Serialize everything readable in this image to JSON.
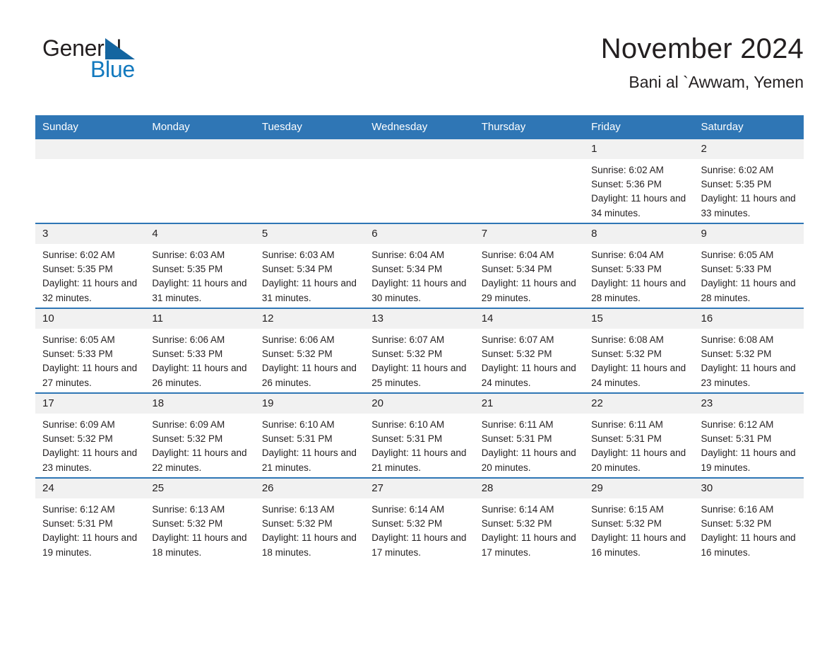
{
  "brand": {
    "word_one": "General",
    "word_two": "Blue",
    "accent_color": "#1279be",
    "triangle_color": "#1465a0"
  },
  "header": {
    "title": "November 2024",
    "subtitle": "Bani al `Awwam, Yemen"
  },
  "theme": {
    "header_row_bg": "#2f76b5",
    "header_row_text": "#ffffff",
    "daynum_bg": "#f1f1f1",
    "row_border": "#2f76b5",
    "text": "#231f20"
  },
  "weekday_headers": [
    "Sunday",
    "Monday",
    "Tuesday",
    "Wednesday",
    "Thursday",
    "Friday",
    "Saturday"
  ],
  "labels": {
    "sunrise_prefix": "Sunrise:",
    "sunset_prefix": "Sunset:",
    "daylight_prefix": "Daylight:"
  },
  "weeks": [
    [
      {
        "day": "",
        "empty": true
      },
      {
        "day": "",
        "empty": true
      },
      {
        "day": "",
        "empty": true
      },
      {
        "day": "",
        "empty": true
      },
      {
        "day": "",
        "empty": true
      },
      {
        "day": "1",
        "sunrise": "Sunrise: 6:02 AM",
        "sunset": "Sunset: 5:36 PM",
        "daylight": "Daylight: 11 hours and 34 minutes."
      },
      {
        "day": "2",
        "sunrise": "Sunrise: 6:02 AM",
        "sunset": "Sunset: 5:35 PM",
        "daylight": "Daylight: 11 hours and 33 minutes."
      }
    ],
    [
      {
        "day": "3",
        "sunrise": "Sunrise: 6:02 AM",
        "sunset": "Sunset: 5:35 PM",
        "daylight": "Daylight: 11 hours and 32 minutes."
      },
      {
        "day": "4",
        "sunrise": "Sunrise: 6:03 AM",
        "sunset": "Sunset: 5:35 PM",
        "daylight": "Daylight: 11 hours and 31 minutes."
      },
      {
        "day": "5",
        "sunrise": "Sunrise: 6:03 AM",
        "sunset": "Sunset: 5:34 PM",
        "daylight": "Daylight: 11 hours and 31 minutes."
      },
      {
        "day": "6",
        "sunrise": "Sunrise: 6:04 AM",
        "sunset": "Sunset: 5:34 PM",
        "daylight": "Daylight: 11 hours and 30 minutes."
      },
      {
        "day": "7",
        "sunrise": "Sunrise: 6:04 AM",
        "sunset": "Sunset: 5:34 PM",
        "daylight": "Daylight: 11 hours and 29 minutes."
      },
      {
        "day": "8",
        "sunrise": "Sunrise: 6:04 AM",
        "sunset": "Sunset: 5:33 PM",
        "daylight": "Daylight: 11 hours and 28 minutes."
      },
      {
        "day": "9",
        "sunrise": "Sunrise: 6:05 AM",
        "sunset": "Sunset: 5:33 PM",
        "daylight": "Daylight: 11 hours and 28 minutes."
      }
    ],
    [
      {
        "day": "10",
        "sunrise": "Sunrise: 6:05 AM",
        "sunset": "Sunset: 5:33 PM",
        "daylight": "Daylight: 11 hours and 27 minutes."
      },
      {
        "day": "11",
        "sunrise": "Sunrise: 6:06 AM",
        "sunset": "Sunset: 5:33 PM",
        "daylight": "Daylight: 11 hours and 26 minutes."
      },
      {
        "day": "12",
        "sunrise": "Sunrise: 6:06 AM",
        "sunset": "Sunset: 5:32 PM",
        "daylight": "Daylight: 11 hours and 26 minutes."
      },
      {
        "day": "13",
        "sunrise": "Sunrise: 6:07 AM",
        "sunset": "Sunset: 5:32 PM",
        "daylight": "Daylight: 11 hours and 25 minutes."
      },
      {
        "day": "14",
        "sunrise": "Sunrise: 6:07 AM",
        "sunset": "Sunset: 5:32 PM",
        "daylight": "Daylight: 11 hours and 24 minutes."
      },
      {
        "day": "15",
        "sunrise": "Sunrise: 6:08 AM",
        "sunset": "Sunset: 5:32 PM",
        "daylight": "Daylight: 11 hours and 24 minutes."
      },
      {
        "day": "16",
        "sunrise": "Sunrise: 6:08 AM",
        "sunset": "Sunset: 5:32 PM",
        "daylight": "Daylight: 11 hours and 23 minutes."
      }
    ],
    [
      {
        "day": "17",
        "sunrise": "Sunrise: 6:09 AM",
        "sunset": "Sunset: 5:32 PM",
        "daylight": "Daylight: 11 hours and 23 minutes."
      },
      {
        "day": "18",
        "sunrise": "Sunrise: 6:09 AM",
        "sunset": "Sunset: 5:32 PM",
        "daylight": "Daylight: 11 hours and 22 minutes."
      },
      {
        "day": "19",
        "sunrise": "Sunrise: 6:10 AM",
        "sunset": "Sunset: 5:31 PM",
        "daylight": "Daylight: 11 hours and 21 minutes."
      },
      {
        "day": "20",
        "sunrise": "Sunrise: 6:10 AM",
        "sunset": "Sunset: 5:31 PM",
        "daylight": "Daylight: 11 hours and 21 minutes."
      },
      {
        "day": "21",
        "sunrise": "Sunrise: 6:11 AM",
        "sunset": "Sunset: 5:31 PM",
        "daylight": "Daylight: 11 hours and 20 minutes."
      },
      {
        "day": "22",
        "sunrise": "Sunrise: 6:11 AM",
        "sunset": "Sunset: 5:31 PM",
        "daylight": "Daylight: 11 hours and 20 minutes."
      },
      {
        "day": "23",
        "sunrise": "Sunrise: 6:12 AM",
        "sunset": "Sunset: 5:31 PM",
        "daylight": "Daylight: 11 hours and 19 minutes."
      }
    ],
    [
      {
        "day": "24",
        "sunrise": "Sunrise: 6:12 AM",
        "sunset": "Sunset: 5:31 PM",
        "daylight": "Daylight: 11 hours and 19 minutes."
      },
      {
        "day": "25",
        "sunrise": "Sunrise: 6:13 AM",
        "sunset": "Sunset: 5:32 PM",
        "daylight": "Daylight: 11 hours and 18 minutes."
      },
      {
        "day": "26",
        "sunrise": "Sunrise: 6:13 AM",
        "sunset": "Sunset: 5:32 PM",
        "daylight": "Daylight: 11 hours and 18 minutes."
      },
      {
        "day": "27",
        "sunrise": "Sunrise: 6:14 AM",
        "sunset": "Sunset: 5:32 PM",
        "daylight": "Daylight: 11 hours and 17 minutes."
      },
      {
        "day": "28",
        "sunrise": "Sunrise: 6:14 AM",
        "sunset": "Sunset: 5:32 PM",
        "daylight": "Daylight: 11 hours and 17 minutes."
      },
      {
        "day": "29",
        "sunrise": "Sunrise: 6:15 AM",
        "sunset": "Sunset: 5:32 PM",
        "daylight": "Daylight: 11 hours and 16 minutes."
      },
      {
        "day": "30",
        "sunrise": "Sunrise: 6:16 AM",
        "sunset": "Sunset: 5:32 PM",
        "daylight": "Daylight: 11 hours and 16 minutes."
      }
    ]
  ]
}
